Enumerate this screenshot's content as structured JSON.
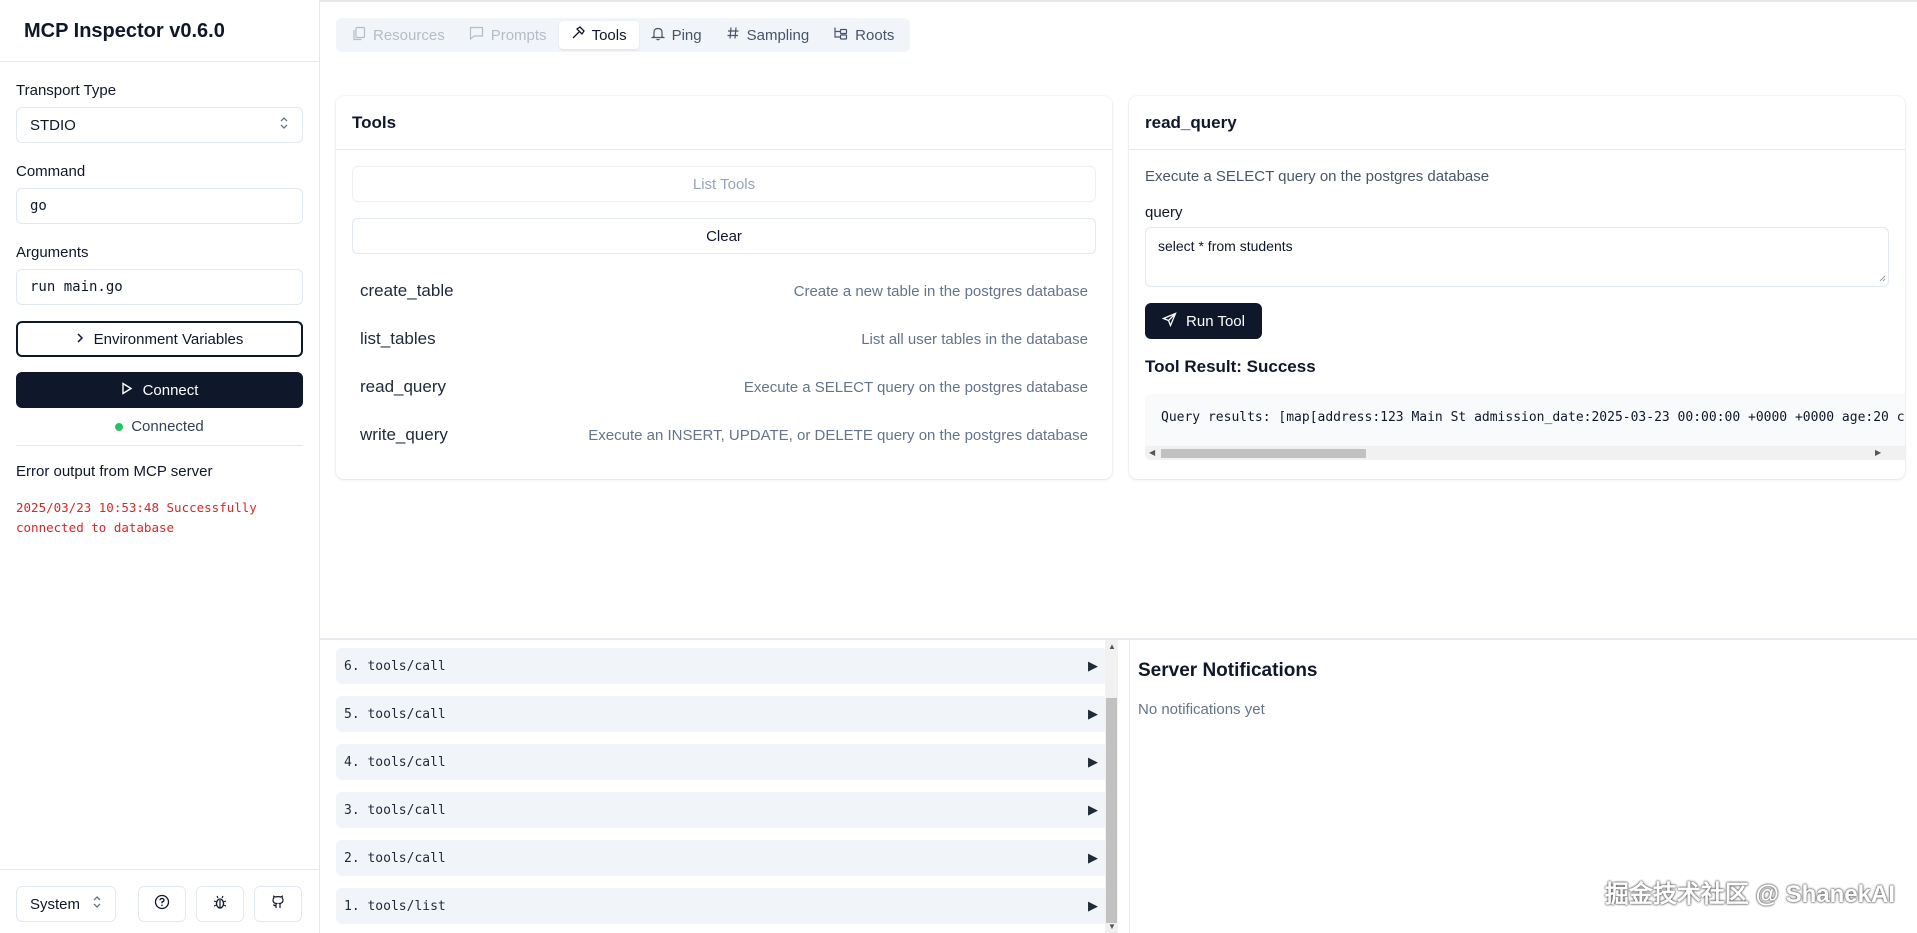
{
  "app": {
    "title": "MCP Inspector v0.6.0"
  },
  "sidebar": {
    "transport_label": "Transport Type",
    "transport_value": "STDIO",
    "command_label": "Command",
    "command_value": "go",
    "arguments_label": "Arguments",
    "arguments_value": "run main.go",
    "env_button": "Environment Variables",
    "connect_button": "Connect",
    "status": "Connected",
    "error_title": "Error output from MCP server",
    "error_text": "2025/03/23 10:53:48 Successfully connected to database",
    "theme_value": "System"
  },
  "tabs": [
    {
      "label": "Resources",
      "icon": "files-icon",
      "state": "disabled"
    },
    {
      "label": "Prompts",
      "icon": "message-icon",
      "state": "disabled"
    },
    {
      "label": "Tools",
      "icon": "hammer-icon",
      "state": "active"
    },
    {
      "label": "Ping",
      "icon": "bell-icon",
      "state": "normal"
    },
    {
      "label": "Sampling",
      "icon": "hash-icon",
      "state": "normal"
    },
    {
      "label": "Roots",
      "icon": "folder-tree-icon",
      "state": "normal"
    }
  ],
  "tools_panel": {
    "title": "Tools",
    "list_button": "List Tools",
    "clear_button": "Clear",
    "tools": [
      {
        "name": "create_table",
        "description": "Create a new table in the postgres database"
      },
      {
        "name": "list_tables",
        "description": "List all user tables in the database"
      },
      {
        "name": "read_query",
        "description": "Execute a SELECT query on the postgres database"
      },
      {
        "name": "write_query",
        "description": "Execute an INSERT, UPDATE, or DELETE query on the postgres database"
      }
    ]
  },
  "tool_detail": {
    "title": "read_query",
    "description": "Execute a SELECT query on the postgres database",
    "param_label": "query",
    "param_value": "select * from students",
    "run_button": "Run Tool",
    "result_title": "Tool Result: Success",
    "result_text": "Query results: [map[address:123 Main St admission_date:2025-03-23 00:00:00 +0000 +0000 age:20 c"
  },
  "history": [
    {
      "label": "6. tools/call"
    },
    {
      "label": "5. tools/call"
    },
    {
      "label": "4. tools/call"
    },
    {
      "label": "3. tools/call"
    },
    {
      "label": "2. tools/call"
    },
    {
      "label": "1. tools/list"
    }
  ],
  "notifications": {
    "title": "Server Notifications",
    "empty_text": "No notifications yet"
  },
  "watermark": "掘金技术社区 @ ShanekAI",
  "colors": {
    "primary": "#0f172a",
    "connected": "#22c55e",
    "error": "#dc2626",
    "muted": "#64748b"
  }
}
